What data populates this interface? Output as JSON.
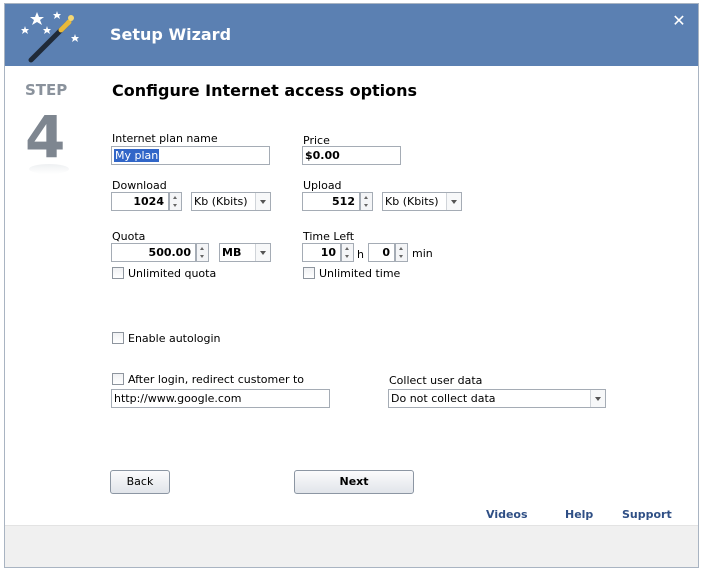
{
  "window": {
    "title": "Setup Wizard",
    "close_glyph": "✕",
    "logo_icon": "magic-wand-icon"
  },
  "step": {
    "label": "STEP",
    "number": "4"
  },
  "heading": "Configure Internet access options",
  "plan": {
    "label": "Internet plan name",
    "value": "My plan"
  },
  "price": {
    "label": "Price",
    "value": "$0.00"
  },
  "download": {
    "label": "Download",
    "value": "1024",
    "unit": "Kb (Kbits)"
  },
  "upload": {
    "label": "Upload",
    "value": "512",
    "unit": "Kb (Kbits)"
  },
  "quota": {
    "label": "Quota",
    "value": "500.00",
    "unit": "MB",
    "unlimited_label": "Unlimited quota",
    "unlimited_checked": false
  },
  "time_left": {
    "label": "Time Left",
    "hours": "10",
    "hours_unit": "h",
    "minutes": "0",
    "minutes_unit": "min",
    "unlimited_label": "Unlimited time",
    "unlimited_checked": false
  },
  "autologin": {
    "label": "Enable autologin",
    "checked": false
  },
  "redirect": {
    "label": "After login, redirect customer to",
    "checked": false,
    "url": "http://www.google.com"
  },
  "collect": {
    "label": "Collect user data",
    "value": "Do not collect data"
  },
  "buttons": {
    "back": "Back",
    "next": "Next"
  },
  "links": {
    "videos": "Videos",
    "help": "Help",
    "support": "Support"
  },
  "colors": {
    "titlebar": "#5b80b2",
    "link": "#2f4f85",
    "selection": "#3166c8"
  }
}
